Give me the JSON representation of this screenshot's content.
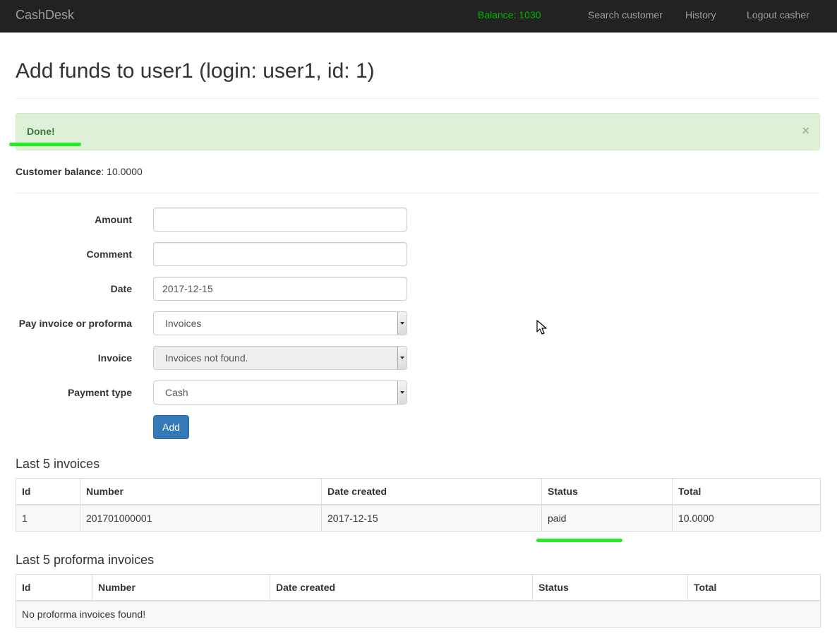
{
  "navbar": {
    "brand": "CashDesk",
    "balance": "Balance: 1030",
    "links": [
      "Search customer",
      "History",
      "Logout casher"
    ]
  },
  "page": {
    "title": "Add funds to user1 (login: user1, id: 1)"
  },
  "alert": {
    "message": "Done!",
    "close": "×"
  },
  "customer": {
    "balance_label": "Customer balance",
    "balance_value": ": 10.0000"
  },
  "form": {
    "amount_label": "Amount",
    "amount_value": "",
    "comment_label": "Comment",
    "comment_value": "",
    "date_label": "Date",
    "date_value": "2017-12-15",
    "pay_label": "Pay invoice or proforma",
    "pay_value": "Invoices",
    "invoice_label": "Invoice",
    "invoice_value": "Invoices not found.",
    "payment_type_label": "Payment type",
    "payment_type_value": "Cash",
    "submit_label": "Add"
  },
  "invoices": {
    "title": "Last 5 invoices",
    "columns": [
      "Id",
      "Number",
      "Date created",
      "Status",
      "Total"
    ],
    "rows": [
      [
        "1",
        "201701000001",
        "2017-12-15",
        "paid",
        "10.0000"
      ]
    ]
  },
  "proformas": {
    "title": "Last 5 proforma invoices",
    "columns": [
      "Id",
      "Number",
      "Date created",
      "Status",
      "Total"
    ],
    "empty_message": "No proforma invoices found!"
  },
  "colors": {
    "navbar_bg": "#222222",
    "balance_green": "#00b400",
    "alert_bg": "#dff0d8",
    "highlight_mark": "#22ee22",
    "primary_button": "#337ab7"
  }
}
